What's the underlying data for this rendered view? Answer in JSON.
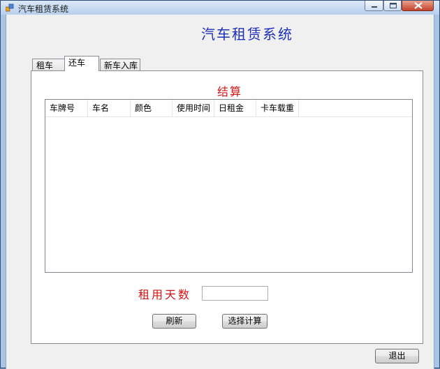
{
  "window": {
    "title": "汽车租赁系统"
  },
  "header": {
    "app_title": "汽车租赁系统"
  },
  "tabs": [
    {
      "label": "租车"
    },
    {
      "label": "还车"
    },
    {
      "label": "新车入库"
    }
  ],
  "active_tab": "还车",
  "return_panel": {
    "section_title": "结算",
    "columns": [
      "车牌号",
      "车名",
      "颜色",
      "使用时间",
      "日租金",
      "卡车载重"
    ],
    "rows": [],
    "days_label": "租用天数",
    "days_value": "",
    "refresh_button": "刷新",
    "calculate_button": "选择计算"
  },
  "footer": {
    "exit_button": "退出"
  },
  "colors": {
    "title_blue": "#1d2fb8",
    "label_red": "#d31414",
    "frame": "#aac4e4"
  }
}
